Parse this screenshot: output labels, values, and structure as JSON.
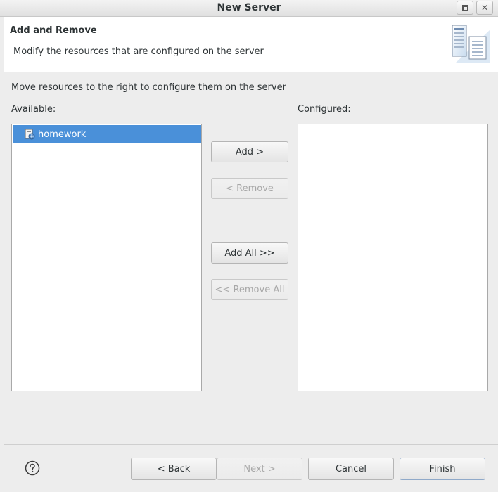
{
  "window": {
    "title": "New Server"
  },
  "header": {
    "title": "Add and Remove",
    "description": "Modify the resources that are configured on the server",
    "icon": "server-wizard-icon"
  },
  "main": {
    "instruction": "Move resources to the right to configure them on the server",
    "available_label": "Available:",
    "configured_label": "Configured:",
    "available_items": [
      {
        "label": "homework",
        "icon": "web-project-icon",
        "selected": true
      }
    ],
    "configured_items": []
  },
  "actions": {
    "add": "Add >",
    "remove": "< Remove",
    "add_all": "Add All >>",
    "remove_all": "<< Remove All"
  },
  "footer": {
    "back": "< Back",
    "next": "Next >",
    "cancel": "Cancel",
    "finish": "Finish"
  },
  "colors": {
    "selection": "#4a90d9",
    "dialog_bg": "#ededed"
  }
}
